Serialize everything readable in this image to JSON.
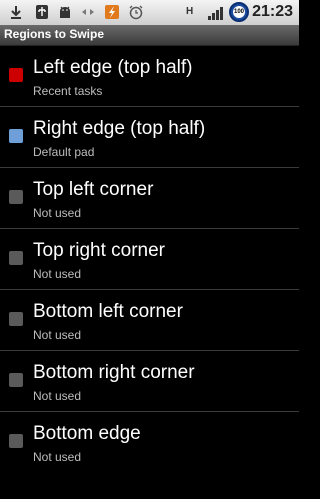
{
  "status_bar": {
    "time": "21:23",
    "network_type": "H",
    "battery_level": "100",
    "icons": [
      "download-icon",
      "usb-icon",
      "android-debug-icon",
      "sync-icon",
      "flash-app-icon",
      "alarm-clock-icon",
      "signal-icon",
      "battery-icon"
    ]
  },
  "title_bar": {
    "title": "Regions to Swipe"
  },
  "regions": [
    {
      "label": "Left edge (top half)",
      "subtitle": "Recent tasks",
      "color": "#cc0000",
      "enabled": true
    },
    {
      "label": "Right edge (top half)",
      "subtitle": "Default pad",
      "color": "#6f9fd8",
      "enabled": true
    },
    {
      "label": "Top left corner",
      "subtitle": "Not used",
      "color": "#5a5a5a",
      "enabled": false
    },
    {
      "label": "Top right corner",
      "subtitle": "Not used",
      "color": "#5a5a5a",
      "enabled": false
    },
    {
      "label": "Bottom left corner",
      "subtitle": "Not used",
      "color": "#5a5a5a",
      "enabled": false
    },
    {
      "label": "Bottom right corner",
      "subtitle": "Not used",
      "color": "#5a5a5a",
      "enabled": false
    },
    {
      "label": "Bottom edge",
      "subtitle": "Not used",
      "color": "#5a5a5a",
      "enabled": false
    }
  ]
}
